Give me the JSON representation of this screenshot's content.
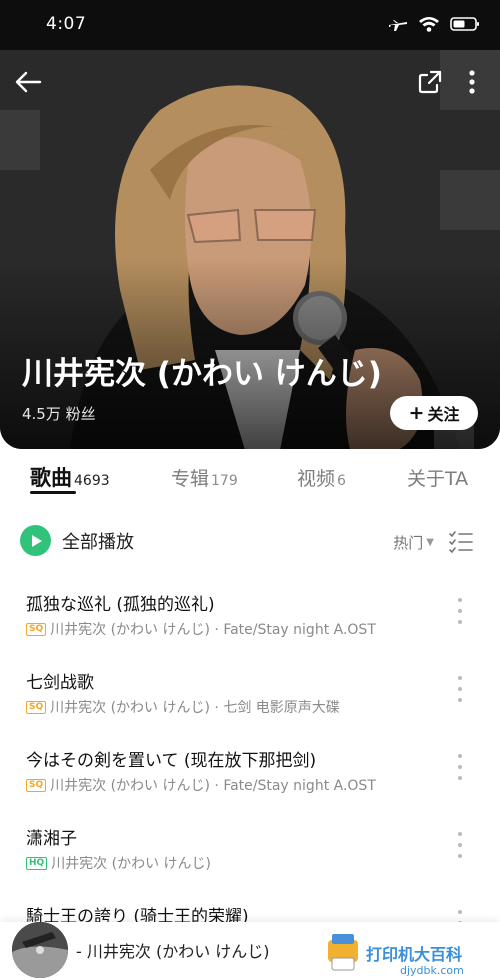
{
  "status_bar": {
    "time": "4:07"
  },
  "header": {
    "artist_name": "川井宪次 (かわい けんじ)",
    "fans": "4.5万 粉丝",
    "follow_label": "关注",
    "follow_icon": "plus-icon"
  },
  "tabs": [
    {
      "label": "歌曲",
      "count": "4693"
    },
    {
      "label": "专辑",
      "count": "179"
    },
    {
      "label": "视频",
      "count": "6"
    },
    {
      "label": "关于TA",
      "count": ""
    }
  ],
  "toolbar": {
    "play_all_label": "全部播放",
    "sort_label": "热门"
  },
  "songs": [
    {
      "title": "孤独な巡礼 (孤独的巡礼)",
      "quality": "SQ",
      "meta": "川井宪次 (かわい けんじ) · Fate/Stay night A.OST"
    },
    {
      "title": "七剑战歌",
      "quality": "SQ",
      "meta": "川井宪次 (かわい けんじ) · 七剑 电影原声大碟"
    },
    {
      "title": "今はその剣を置いて (现在放下那把剑)",
      "quality": "SQ",
      "meta": "川井宪次 (かわい けんじ) · Fate/Stay night A.OST"
    },
    {
      "title": "潇湘子",
      "quality": "HQ",
      "meta": "川井宪次 (かわい けんじ)"
    },
    {
      "title": "騎士王の誇り (骑士王的荣耀)",
      "quality": "",
      "meta": ""
    }
  ],
  "mini_player": {
    "now_playing": "- 川井宪次 (かわい けんじ)",
    "watermark_text": "打印机大百科  djydbk.com"
  },
  "colors": {
    "accent_green": "#31c27c",
    "sq_badge": "#f5a623",
    "hq_badge": "#31c27c"
  }
}
